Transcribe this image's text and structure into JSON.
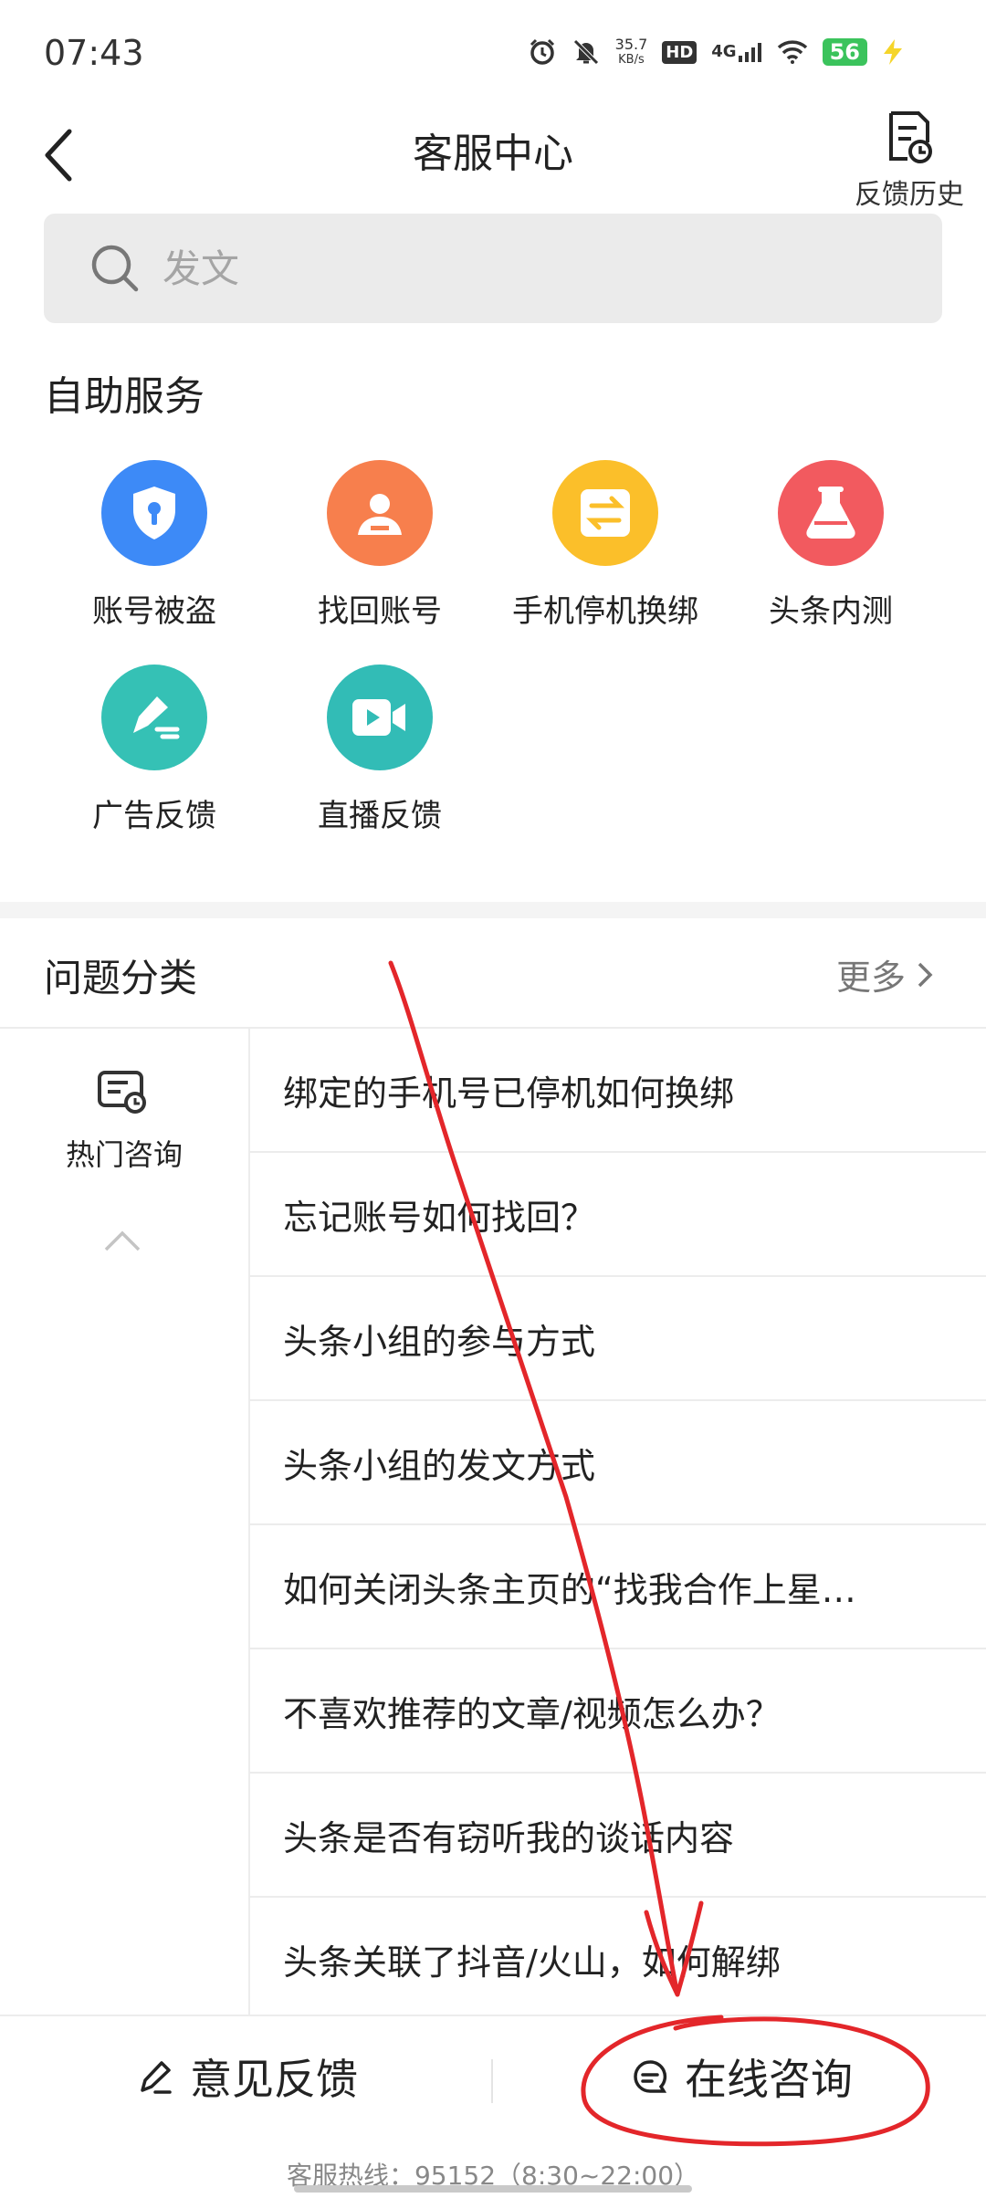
{
  "status_bar": {
    "time": "07:43",
    "net_speed_value": "35.7",
    "net_speed_unit": "KB/s",
    "hd": "HD",
    "network": "4G",
    "battery": "56",
    "icons": [
      "alarm-icon",
      "mute-bell-icon",
      "signal-icon",
      "wifi-icon",
      "charging-icon"
    ]
  },
  "header": {
    "title": "客服中心",
    "history_label": "反馈历史",
    "back_icon": "chevron-left-icon"
  },
  "search": {
    "placeholder": "发文"
  },
  "self_service": {
    "title": "自助服务",
    "items": [
      {
        "label": "账号被盗",
        "icon": "shield-lock-icon",
        "color": "#3d8af7"
      },
      {
        "label": "找回账号",
        "icon": "user-card-icon",
        "color": "#f77f4d"
      },
      {
        "label": "手机停机换绑",
        "icon": "swap-icon",
        "color": "#fbbf2a"
      },
      {
        "label": "头条内测",
        "icon": "flask-icon",
        "color": "#f25a5f"
      },
      {
        "label": "广告反馈",
        "icon": "pen-edit-icon",
        "color": "#35c1b5"
      },
      {
        "label": "直播反馈",
        "icon": "video-camera-icon",
        "color": "#32bcb6"
      }
    ]
  },
  "categories": {
    "title": "问题分类",
    "more": "更多",
    "hot_label": "热门咨询",
    "questions": [
      "绑定的手机号已停机如何换绑",
      "忘记账号如何找回？",
      "头条小组的参与方式",
      "头条小组的发文方式",
      "如何关闭头条主页的“找我合作上星…",
      "不喜欢推荐的文章/视频怎么办？",
      "头条是否有窃听我的谈话内容",
      "头条关联了抖音/火山，如何解绑"
    ]
  },
  "bottom": {
    "feedback_label": "意见反馈",
    "consult_label": "在线咨询",
    "hotline": "客服热线：95152（8:30~22:00）"
  },
  "colors": {
    "annotation": "#e3262a",
    "search_bg": "#ebebeb"
  }
}
